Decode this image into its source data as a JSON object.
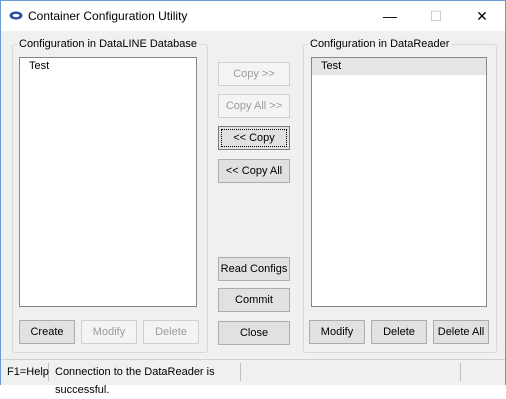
{
  "window": {
    "title": "Container Configuration Utility",
    "minimize_glyph": "—",
    "maximize_glyph": "☐",
    "close_glyph": "✕"
  },
  "left_panel": {
    "legend": "Configuration in DataLINE Database",
    "items": [
      "Test"
    ],
    "create_label": "Create",
    "modify_label": "Modify",
    "delete_label": "Delete"
  },
  "right_panel": {
    "legend": "Configuration in DataReader",
    "items": [
      "Test"
    ],
    "modify_label": "Modify",
    "delete_label": "Delete",
    "delete_all_label": "Delete All"
  },
  "center": {
    "copy_right_label": "Copy >>",
    "copy_all_right_label": "Copy All >>",
    "copy_left_label": "<< Copy",
    "copy_all_left_label": "<< Copy All",
    "read_configs_label": "Read Configs",
    "commit_label": "Commit",
    "close_label": "Close"
  },
  "status_bar": {
    "help": "F1=Help",
    "message": "Connection to the DataReader is successful."
  },
  "colors": {
    "window_border": "#6b9bd1",
    "selected_row": "#e5e5e5",
    "button_face": "#e1e1e1",
    "disabled_text": "#9b9b9b"
  }
}
